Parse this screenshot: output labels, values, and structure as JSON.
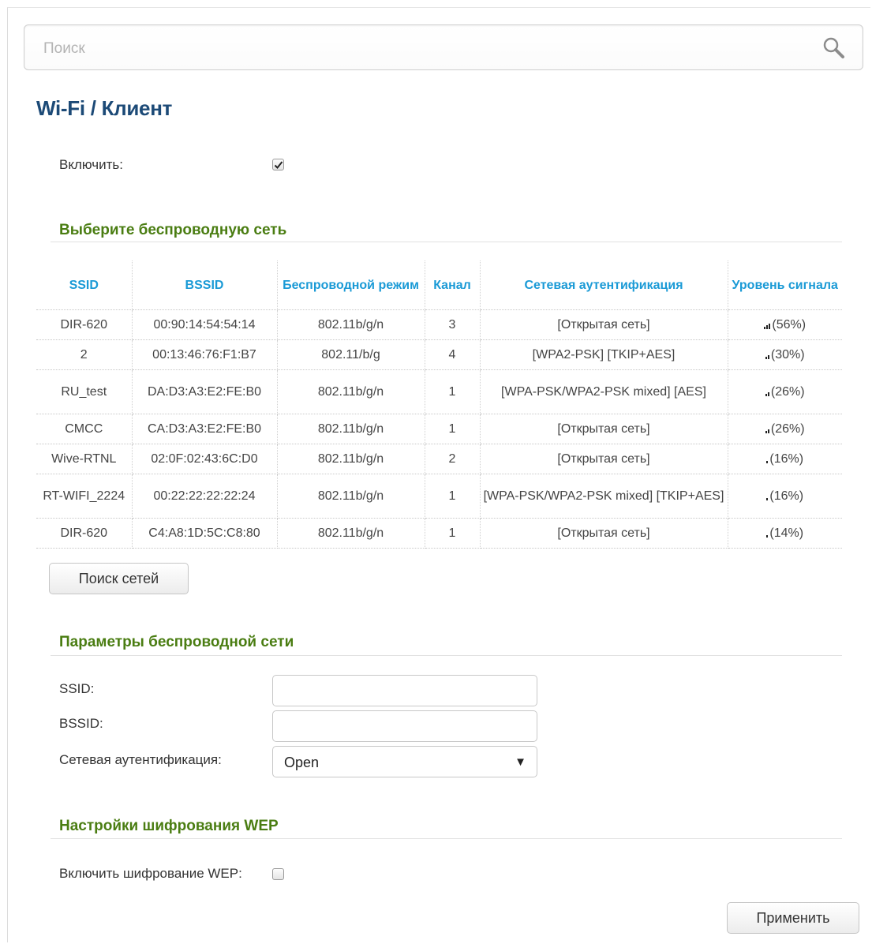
{
  "search": {
    "placeholder": "Поиск"
  },
  "header": {
    "title": "Wi-Fi /  Клиент"
  },
  "enable": {
    "label": "Включить:",
    "checked": true
  },
  "networks_section": {
    "title": "Выберите беспроводную сеть",
    "columns": [
      "SSID",
      "BSSID",
      "Беспроводной режим",
      "Канал",
      "Сетевая аутентификация",
      "Уровень сигнала"
    ],
    "rows": [
      {
        "ssid": "DIR-620",
        "bssid": "00:90:14:54:54:14",
        "mode": "802.11b/g/n",
        "channel": "3",
        "auth": "[Открытая сеть]",
        "signal": "(56%)",
        "bars": 3
      },
      {
        "ssid": "2",
        "bssid": "00:13:46:76:F1:B7",
        "mode": "802.11/b/g",
        "channel": "4",
        "auth": "[WPA2-PSK] [TKIP+AES]",
        "signal": "(30%)",
        "bars": 2
      },
      {
        "ssid": "RU_test",
        "bssid": "DA:D3:A3:E2:FE:B0",
        "mode": "802.11b/g/n",
        "channel": "1",
        "auth": "[WPA-PSK/WPA2-PSK mixed] [AES]",
        "signal": "(26%)",
        "bars": 2
      },
      {
        "ssid": "CMCC",
        "bssid": "CA:D3:A3:E2:FE:B0",
        "mode": "802.11b/g/n",
        "channel": "1",
        "auth": "[Открытая сеть]",
        "signal": "(26%)",
        "bars": 2
      },
      {
        "ssid": "Wive-RTNL",
        "bssid": "02:0F:02:43:6C:D0",
        "mode": "802.11b/g/n",
        "channel": "2",
        "auth": "[Открытая сеть]",
        "signal": "(16%)",
        "bars": 1
      },
      {
        "ssid": "RT-WIFI_2224",
        "bssid": "00:22:22:22:22:24",
        "mode": "802.11b/g/n",
        "channel": "1",
        "auth": "[WPA-PSK/WPA2-PSK mixed] [TKIP+AES]",
        "signal": "(16%)",
        "bars": 1
      },
      {
        "ssid": "DIR-620",
        "bssid": "C4:A8:1D:5C:C8:80",
        "mode": "802.11b/g/n",
        "channel": "1",
        "auth": "[Открытая сеть]",
        "signal": "(14%)",
        "bars": 1
      }
    ],
    "scan_button": "Поиск сетей"
  },
  "params_section": {
    "title": "Параметры беспроводной сети",
    "ssid_label": "SSID:",
    "ssid_value": "",
    "bssid_label": "BSSID:",
    "bssid_value": "",
    "auth_label": "Сетевая аутентификация:",
    "auth_value": "Open"
  },
  "wep_section": {
    "title": "Настройки шифрования WEP",
    "enable_label": "Включить шифрование WEP:",
    "enabled": false
  },
  "apply_button": "Применить",
  "colors": {
    "title": "#1c4a77",
    "section": "#4a7d12",
    "table_header": "#1a9ad6"
  }
}
